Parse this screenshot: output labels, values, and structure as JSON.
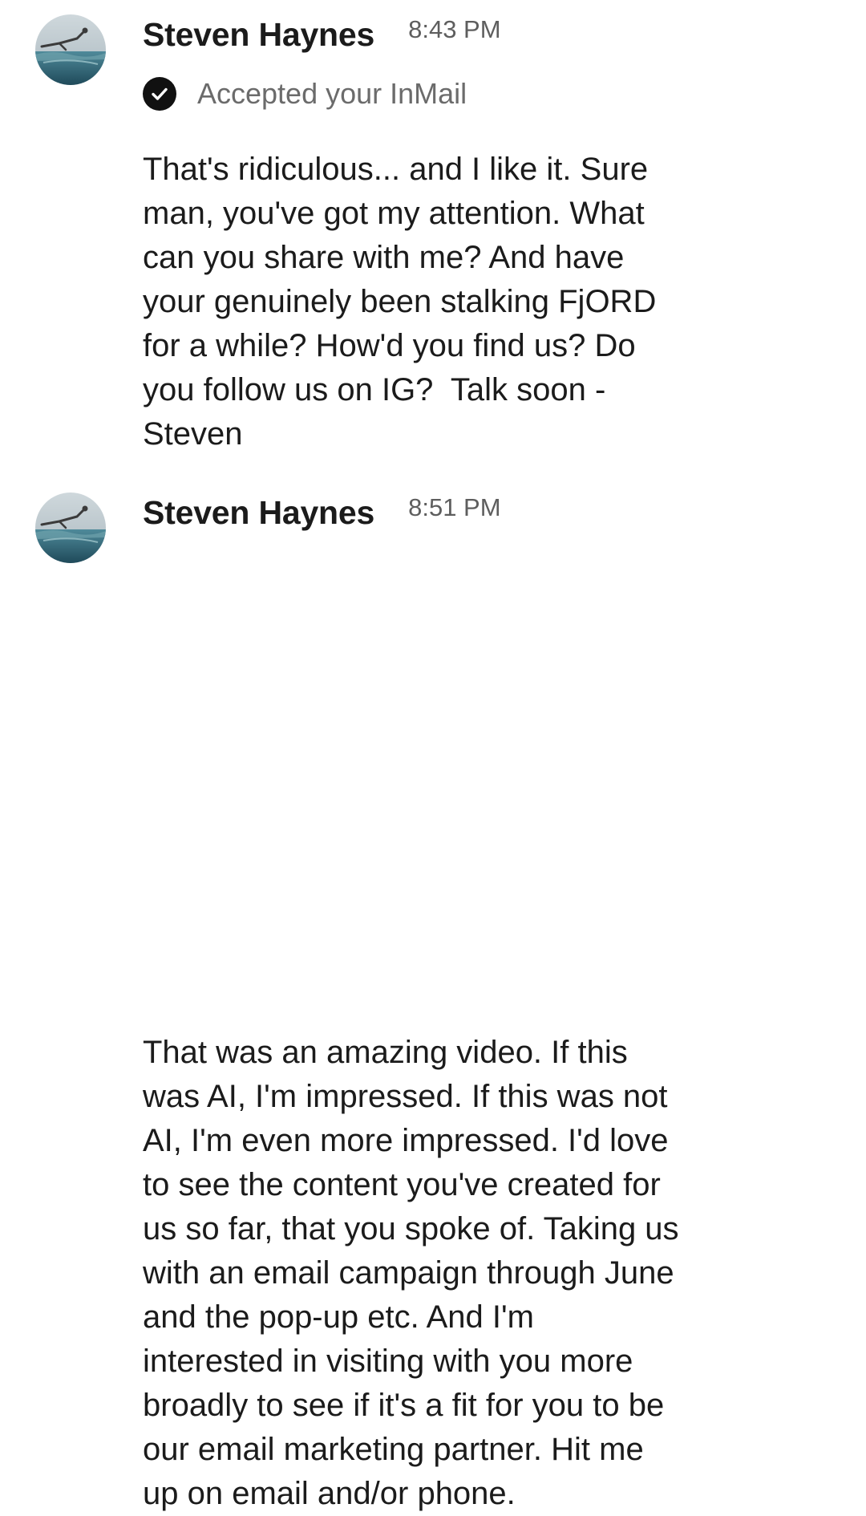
{
  "colors": {
    "name": "#1b1b1b",
    "timestamp": "#5e5e5e",
    "secondary_text": "#6b6b6b",
    "check_badge": "#111111",
    "background": "#ffffff"
  },
  "messages": [
    {
      "sender": "Steven Haynes",
      "time": "8:43 PM",
      "avatar_icon": "profile-photo-ocean-diver",
      "status_icon": "check-circle-icon",
      "status": "Accepted your InMail",
      "lines": [
        "That's ridiculous... and I like it. Sure",
        "man, you've got my attention. What",
        "can you share with me? And have",
        "your genuinely been stalking FjORD",
        "for a while? How'd you find us? Do",
        "you follow us on IG?  Talk soon -",
        "Steven"
      ]
    },
    {
      "sender": "Steven Haynes",
      "time": "8:51 PM",
      "avatar_icon": "profile-photo-ocean-diver",
      "lines": [
        "That was an amazing video. If this",
        "was AI, I'm impressed. If this was not",
        "AI, I'm even more impressed. I'd love",
        "to see the content you've created for",
        "us so far, that you spoke of. Taking us",
        "with an email campaign through June",
        "and the pop-up etc. And I'm",
        "interested in visiting with you more",
        "broadly to see if it's a fit for you to be",
        "our email marketing partner. Hit me",
        "up on email and/or phone."
      ]
    }
  ]
}
